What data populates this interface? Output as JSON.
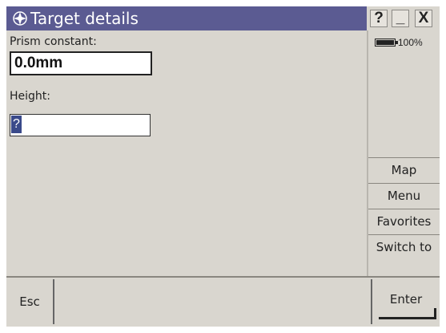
{
  "window": {
    "title": "Target details",
    "icon": "target-rose-icon",
    "help_label": "?",
    "minimize_label": "_",
    "close_label": "X"
  },
  "form": {
    "prism_label": "Prism constant:",
    "prism_value": "0.0mm",
    "height_label": "Height:",
    "height_value": "?"
  },
  "status": {
    "battery_percent": "100%",
    "battery_level": 1.0
  },
  "sidebar": {
    "items": [
      {
        "label": "Map",
        "hotkey": "M"
      },
      {
        "label": "Menu",
        "hotkey": "n"
      },
      {
        "label": "Favorites",
        "hotkey": "a"
      },
      {
        "label": "Switch to",
        "hotkey": "w"
      }
    ]
  },
  "bottom": {
    "esc_label": "Esc",
    "enter_label": "Enter"
  },
  "colors": {
    "titlebar": "#5b5b92",
    "background": "#d9d6cf",
    "selection": "#3a4a8a"
  }
}
